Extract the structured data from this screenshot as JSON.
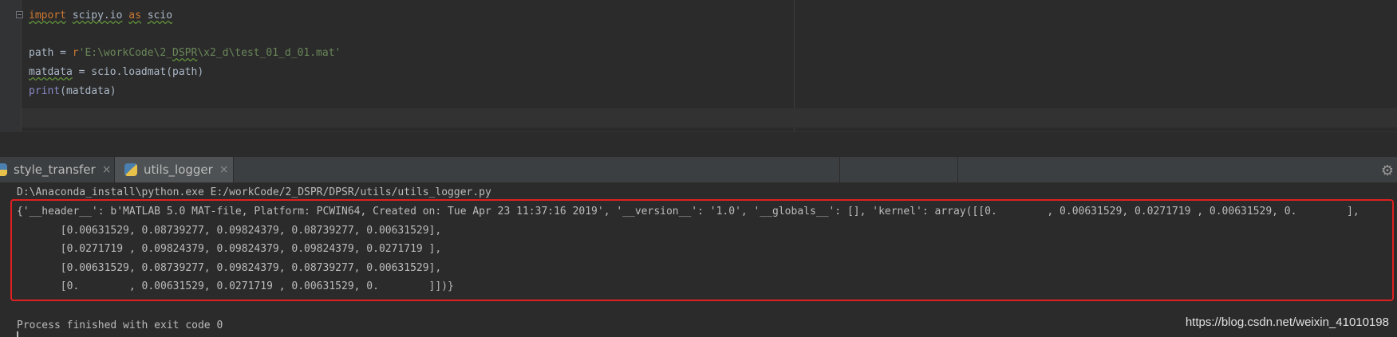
{
  "editor": {
    "lines": [
      {
        "kw1": "import",
        "mod": "scipy.io",
        "kw2": "as",
        "alias": "scio"
      },
      {
        "var": "path",
        "op": " = ",
        "prefix": "r",
        "str_a": "'E:\\workCode\\2_",
        "str_dspr": "DSPR",
        "str_b": "\\x2_d\\test_01_d_01.mat'"
      },
      {
        "var": "matdata",
        "rest": " = scio.loadmat(path)"
      },
      {
        "fn": "print",
        "rest": "(matdata)"
      }
    ]
  },
  "tabs": [
    {
      "label": "style_transfer",
      "close": "×",
      "active": false
    },
    {
      "label": "utils_logger",
      "close": "×",
      "active": true
    }
  ],
  "console": {
    "command": "D:\\Anaconda_install\\python.exe E:/workCode/2_DSPR/DPSR/utils/utils_logger.py",
    "output": [
      "{'__header__': b'MATLAB 5.0 MAT-file, Platform: PCWIN64, Created on: Tue Apr 23 11:37:16 2019', '__version__': '1.0', '__globals__': [], 'kernel': array([[0.        , 0.00631529, 0.0271719 , 0.00631529, 0.        ],",
      "       [0.00631529, 0.08739277, 0.09824379, 0.08739277, 0.00631529],",
      "       [0.0271719 , 0.09824379, 0.09824379, 0.09824379, 0.0271719 ],",
      "       [0.00631529, 0.08739277, 0.09824379, 0.08739277, 0.00631529],",
      "       [0.        , 0.00631529, 0.0271719 , 0.00631529, 0.        ]])}"
    ],
    "exit_message": "Process finished with exit code 0"
  },
  "watermark": "https://blog.csdn.net/weixin_41010198",
  "colors": {
    "keyword": "#cc7832",
    "string": "#6a8759",
    "builtin": "#8888c6",
    "highlight_box": "#e02020"
  }
}
